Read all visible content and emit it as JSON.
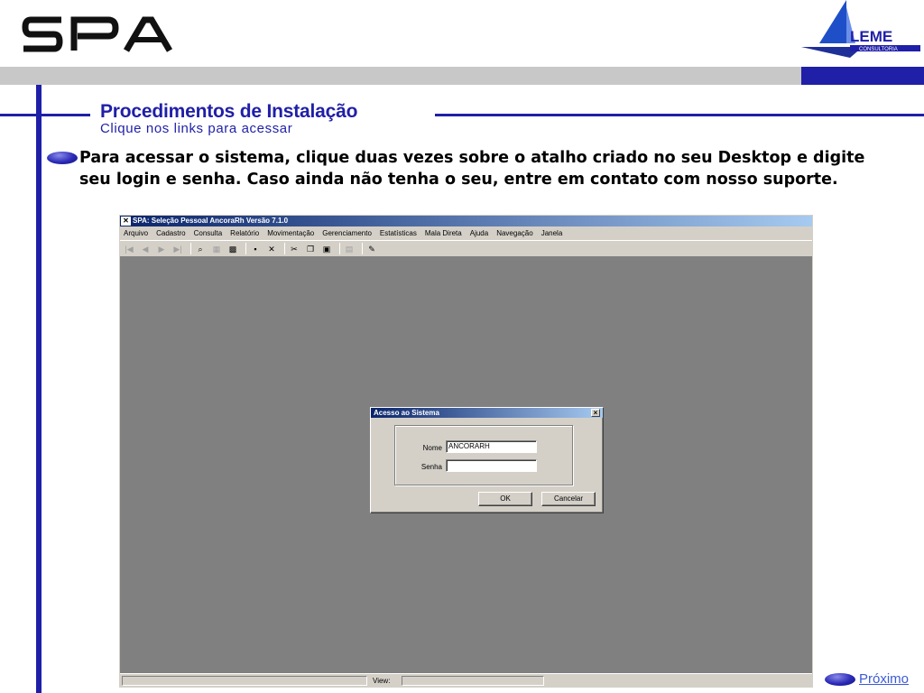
{
  "header": {
    "logo_text": "SPA",
    "partner_logo_text": "LEME",
    "partner_logo_sub": "CONSULTORIA"
  },
  "slide": {
    "title": "Procedimentos de Instalação",
    "subtitle": "Clique nos links para acessar",
    "paragraph": "Para acessar o sistema, clique duas vezes sobre o atalho criado no seu Desktop e digite seu login e senha. Caso ainda não tenha o seu, entre em contato com nosso suporte.",
    "next_link": "Próximo"
  },
  "app": {
    "title": "SPA: Seleção Pessoal AncoraRh   Versão 7.1.0",
    "menu": [
      "Arquivo",
      "Cadastro",
      "Consulta",
      "Relatório",
      "Movimentação",
      "Gerenciamento",
      "Estatísticas",
      "Mala Direta",
      "Ajuda",
      "Navegação",
      "Janela"
    ],
    "status_view_label": "View:"
  },
  "dialog": {
    "title": "Acesso ao Sistema",
    "close_label": "×",
    "nome_label": "Nome",
    "nome_value": "ANCORARH",
    "senha_label": "Senha",
    "senha_value": "",
    "ok_label": "OK",
    "cancel_label": "Cancelar"
  },
  "colors": {
    "brand_blue": "#1f1fa8",
    "band_gray": "#c8c8c8",
    "link_blue": "#3b5bd6",
    "workspace_gray": "#808080"
  }
}
